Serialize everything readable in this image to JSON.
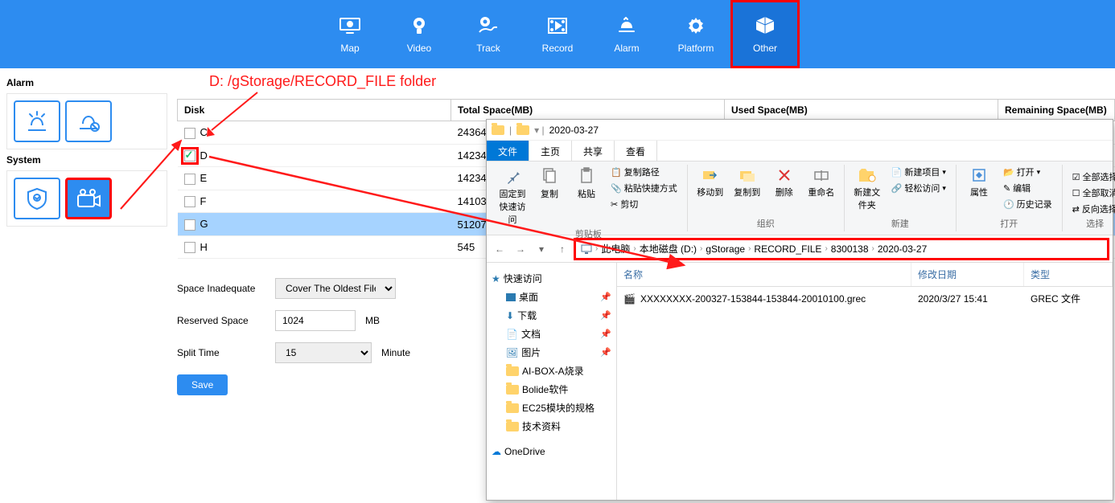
{
  "nav": {
    "items": [
      {
        "label": "Map",
        "icon": "monitor-icon"
      },
      {
        "label": "Video",
        "icon": "camera-icon"
      },
      {
        "label": "Track",
        "icon": "track-icon"
      },
      {
        "label": "Record",
        "icon": "record-icon"
      },
      {
        "label": "Alarm",
        "icon": "alarm-icon"
      },
      {
        "label": "Platform",
        "icon": "platform-icon"
      },
      {
        "label": "Other",
        "icon": "other-icon",
        "active": true
      }
    ]
  },
  "left": {
    "section1": "Alarm",
    "section2": "System"
  },
  "annotation": "D: /gStorage/RECORD_FILE folder",
  "table": {
    "headers": [
      "Disk",
      "Total Space(MB)",
      "Used Space(MB)",
      "Remaining Space(MB)"
    ],
    "rows": [
      {
        "disk": "C",
        "total": "24364",
        "checked": false
      },
      {
        "disk": "D",
        "total": "14234",
        "checked": true,
        "checkedBox": true
      },
      {
        "disk": "E",
        "total": "14234",
        "checked": false
      },
      {
        "disk": "F",
        "total": "14103",
        "checked": false
      },
      {
        "disk": "G",
        "total": "51207",
        "checked": false,
        "selected": true
      },
      {
        "disk": "H",
        "total": "545",
        "checked": false
      }
    ]
  },
  "settings": {
    "space_inadequate_label": "Space Inadequate",
    "space_inadequate_value": "Cover The Oldest Files",
    "reserved_label": "Reserved Space",
    "reserved_value": "1024",
    "reserved_unit": "MB",
    "split_label": "Split Time",
    "split_value": "15",
    "split_unit": "Minute",
    "save_label": "Save"
  },
  "explorer": {
    "title_date": "2020-03-27",
    "tabs": [
      "文件",
      "主页",
      "共享",
      "查看"
    ],
    "ribbon": {
      "pin": "固定到快速访问",
      "copy": "复制",
      "paste": "粘贴",
      "copy_path": "复制路径",
      "paste_shortcut": "粘贴快捷方式",
      "cut": "剪切",
      "clipboard_group": "剪贴板",
      "move_to": "移动到",
      "copy_to": "复制到",
      "delete": "删除",
      "rename": "重命名",
      "organize_group": "组织",
      "new_folder": "新建文件夹",
      "new_item": "新建项目",
      "easy_access": "轻松访问",
      "new_group": "新建",
      "properties": "属性",
      "open": "打开",
      "edit": "编辑",
      "history": "历史记录",
      "open_group": "打开",
      "select_all": "全部选择",
      "select_none": "全部取消",
      "invert": "反向选择",
      "select_group": "选择"
    },
    "breadcrumb": [
      "此电脑",
      "本地磁盘 (D:)",
      "gStorage",
      "RECORD_FILE",
      "8300138",
      "2020-03-27"
    ],
    "side": {
      "quick_access": "快速访问",
      "desktop": "桌面",
      "downloads": "下载",
      "documents": "文档",
      "pictures": "图片",
      "folder1": "AI-BOX-A烧录",
      "folder2": "Bolide软件",
      "folder3": "EC25模块的规格",
      "folder4": "技术资料",
      "onedrive": "OneDrive"
    },
    "file_headers": {
      "name": "名称",
      "date": "修改日期",
      "type": "类型"
    },
    "files": [
      {
        "name": "XXXXXXXX-200327-153844-153844-20010100.grec",
        "date": "2020/3/27 15:41",
        "type": "GREC 文件"
      }
    ]
  }
}
